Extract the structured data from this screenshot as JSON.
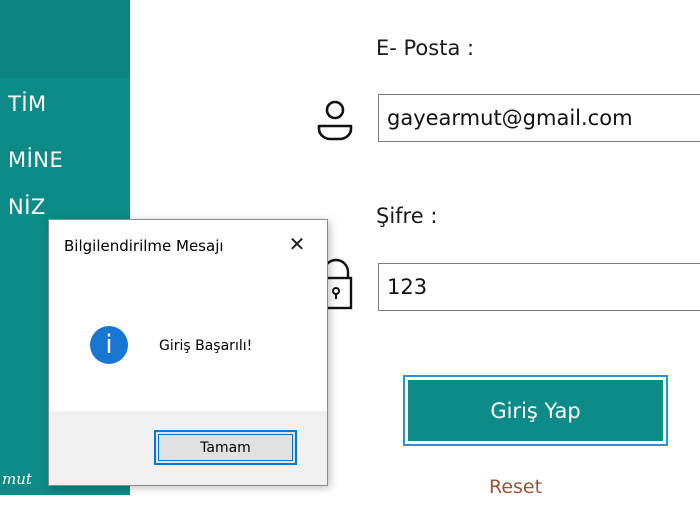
{
  "left_panel": {
    "lines": [
      "TİM",
      "MİNE",
      "NİZ"
    ],
    "footer": "mut"
  },
  "form": {
    "email_label": "E- Posta :",
    "email_value": "gayearmut@gmail.com",
    "password_label": "Şifre :",
    "password_value": "123",
    "login_label": "Giriş Yap",
    "reset_label": "Reset"
  },
  "dialog": {
    "title": "Bilgilendirilme Mesajı",
    "close_glyph": "✕",
    "icon_glyph": "i",
    "message": "Giriş Başarılı!",
    "ok_label": "Tamam"
  },
  "colors": {
    "panel": "#0d8b88",
    "accent": "#2f8ee0",
    "reset": "#a0522d",
    "info": "#1976d2"
  },
  "icons": [
    "user-icon",
    "lock-icon",
    "close-icon",
    "info-icon"
  ]
}
